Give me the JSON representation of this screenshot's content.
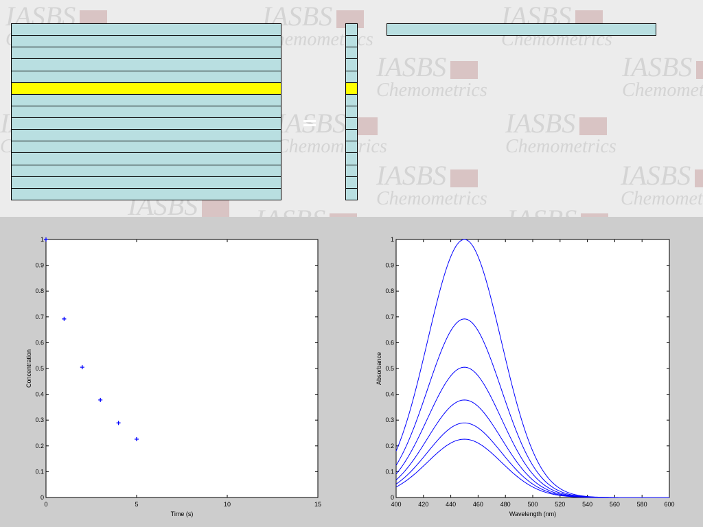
{
  "watermark": {
    "line1": "IASBS",
    "line2": "Chemometrics"
  },
  "matrix": {
    "rows": 15,
    "highlight_row": 5
  },
  "colors": {
    "cell": "#b9dfe1",
    "highlight": "#ffff00",
    "curve": "#0000ff",
    "background": "#cdcdcd"
  },
  "chart_data": [
    {
      "type": "scatter",
      "xlabel": "Time  (s)",
      "ylabel": "Concentration",
      "xlim": [
        0,
        15
      ],
      "ylim": [
        0,
        1
      ],
      "xticks": [
        0,
        5,
        10,
        15
      ],
      "yticks": [
        0,
        0.1,
        0.2,
        0.3,
        0.4,
        0.5,
        0.6,
        0.7,
        0.8,
        0.9,
        1
      ],
      "marker": "+",
      "x": [
        0,
        1,
        2,
        3,
        4,
        5
      ],
      "y": [
        1,
        0.692,
        0.505,
        0.378,
        0.289,
        0.226
      ]
    },
    {
      "type": "line",
      "xlabel": "Wavelength  (nm)",
      "ylabel": "Absorbance",
      "xlim": [
        400,
        600
      ],
      "ylim": [
        0,
        1
      ],
      "xticks": [
        400,
        420,
        440,
        460,
        480,
        500,
        520,
        540,
        560,
        580,
        600
      ],
      "yticks": [
        0,
        0.1,
        0.2,
        0.3,
        0.4,
        0.5,
        0.6,
        0.7,
        0.8,
        0.9,
        1
      ],
      "peak_wavelength": 450,
      "band_width": 27,
      "peak_absorbances": [
        1,
        0.692,
        0.505,
        0.378,
        0.289,
        0.226
      ]
    }
  ]
}
